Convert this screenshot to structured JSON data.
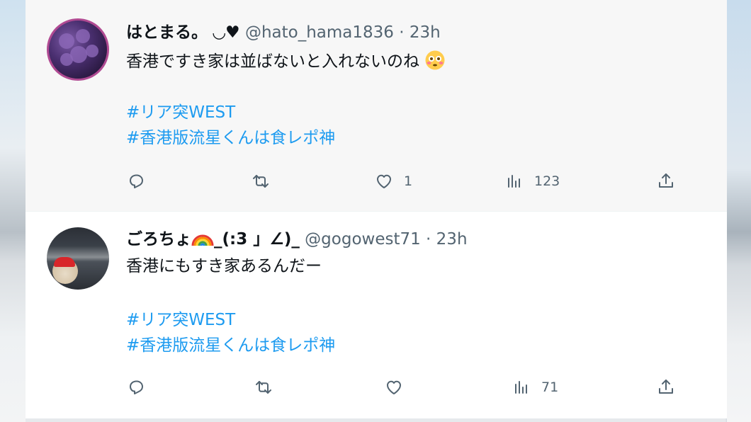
{
  "tweets": [
    {
      "display_name": "はとまる。",
      "name_suffix": "◡♥",
      "meta": "@hato_hama1836 · 23h",
      "text": "香港ですき家は並ばないと入れないのね",
      "emoji": "flushed-face",
      "hashtags": [
        "#リア突WEST",
        "#香港版流星くんは食レポ神"
      ],
      "likes": "1",
      "views": "123"
    },
    {
      "display_name": "ごろちょ",
      "name_suffix": "_(:3 」∠)_",
      "meta": "@gogowest71 · 23h",
      "text": "香港にもすき家あるんだー",
      "emoji": "rainbow",
      "hashtags": [
        "#リア突WEST",
        "#香港版流星くんは食レポ神"
      ],
      "likes": "",
      "views": "71"
    }
  ],
  "icons": {
    "reply": "reply-icon",
    "retweet": "retweet-icon",
    "like": "heart-icon",
    "views": "views-icon",
    "share": "share-icon"
  },
  "colors": {
    "link": "#1d9bf0",
    "meta": "#536471",
    "text": "#0f1419"
  }
}
